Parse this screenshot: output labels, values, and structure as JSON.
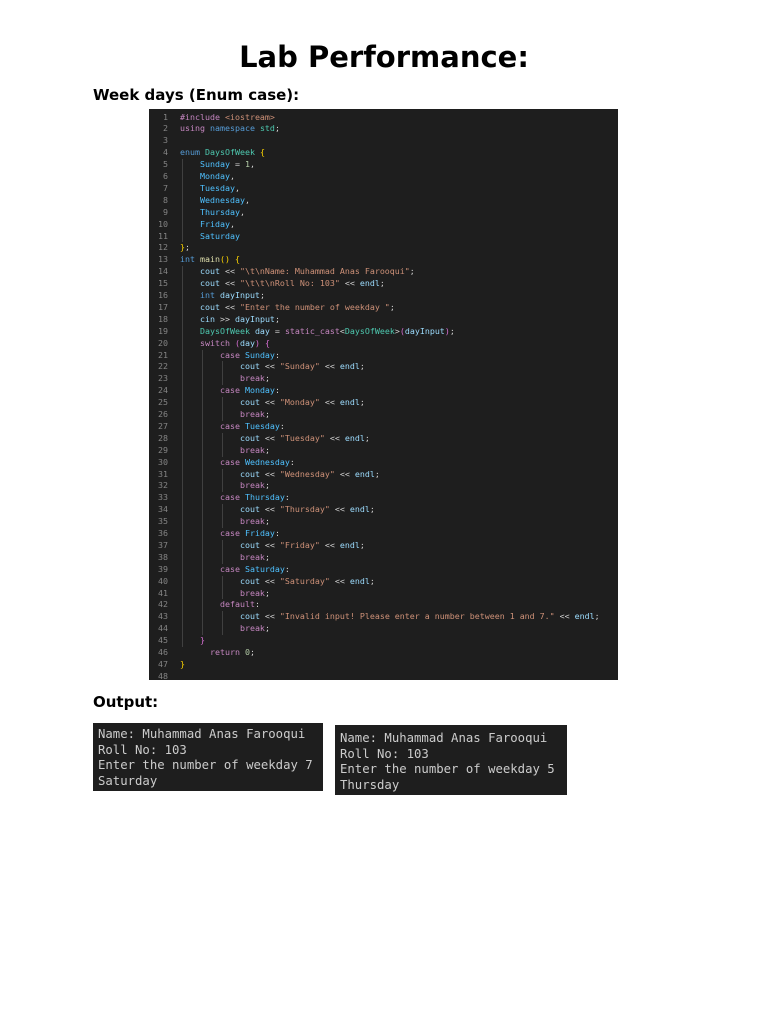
{
  "page": {
    "title": "Lab Performance:",
    "section_heading": "Week days (Enum case):",
    "output_heading": "Output:"
  },
  "code": {
    "lines": [
      {
        "n": "1",
        "tokens": [
          [
            "pre",
            "#include "
          ],
          [
            "inc",
            "<iostream>"
          ]
        ]
      },
      {
        "n": "2",
        "tokens": [
          [
            "pre",
            "using "
          ],
          [
            "kw",
            "namespace "
          ],
          [
            "ty",
            "std"
          ],
          [
            "op",
            ";"
          ]
        ]
      },
      {
        "n": "3",
        "tokens": []
      },
      {
        "n": "4",
        "tokens": [
          [
            "kw",
            "enum "
          ],
          [
            "ty",
            "DaysOfWeek "
          ],
          [
            "br1",
            "{"
          ]
        ]
      },
      {
        "n": "5",
        "tokens": [
          [
            "op",
            "    "
          ],
          [
            "enm",
            "Sunday"
          ],
          [
            "op",
            " = "
          ],
          [
            "num",
            "1"
          ],
          [
            "op",
            ","
          ]
        ]
      },
      {
        "n": "6",
        "tokens": [
          [
            "op",
            "    "
          ],
          [
            "enm",
            "Monday"
          ],
          [
            "op",
            ","
          ]
        ]
      },
      {
        "n": "7",
        "tokens": [
          [
            "op",
            "    "
          ],
          [
            "enm",
            "Tuesday"
          ],
          [
            "op",
            ","
          ]
        ]
      },
      {
        "n": "8",
        "tokens": [
          [
            "op",
            "    "
          ],
          [
            "enm",
            "Wednesday"
          ],
          [
            "op",
            ","
          ]
        ]
      },
      {
        "n": "9",
        "tokens": [
          [
            "op",
            "    "
          ],
          [
            "enm",
            "Thursday"
          ],
          [
            "op",
            ","
          ]
        ]
      },
      {
        "n": "10",
        "tokens": [
          [
            "op",
            "    "
          ],
          [
            "enm",
            "Friday"
          ],
          [
            "op",
            ","
          ]
        ]
      },
      {
        "n": "11",
        "tokens": [
          [
            "op",
            "    "
          ],
          [
            "enm",
            "Saturday"
          ]
        ]
      },
      {
        "n": "12",
        "tokens": [
          [
            "br1",
            "}"
          ],
          [
            "op",
            ";"
          ]
        ]
      },
      {
        "n": "13",
        "tokens": [
          [
            "kw",
            "int "
          ],
          [
            "fn",
            "main"
          ],
          [
            "br1",
            "()"
          ],
          [
            "op",
            " "
          ],
          [
            "br1",
            "{"
          ]
        ]
      },
      {
        "n": "14",
        "tokens": [
          [
            "op",
            "    "
          ],
          [
            "var",
            "cout"
          ],
          [
            "op",
            " << "
          ],
          [
            "str",
            "\"\\t\\nName: Muhammad Anas Farooqui\""
          ],
          [
            "op",
            ";"
          ]
        ]
      },
      {
        "n": "15",
        "tokens": [
          [
            "op",
            "    "
          ],
          [
            "var",
            "cout"
          ],
          [
            "op",
            " << "
          ],
          [
            "str",
            "\"\\t\\t\\nRoll No: 103\""
          ],
          [
            "op",
            " << "
          ],
          [
            "var",
            "endl"
          ],
          [
            "op",
            ";"
          ]
        ]
      },
      {
        "n": "16",
        "tokens": [
          [
            "op",
            "    "
          ],
          [
            "kw",
            "int "
          ],
          [
            "var",
            "dayInput"
          ],
          [
            "op",
            ";"
          ]
        ]
      },
      {
        "n": "17",
        "tokens": [
          [
            "op",
            "    "
          ],
          [
            "var",
            "cout"
          ],
          [
            "op",
            " << "
          ],
          [
            "str",
            "\"Enter the number of weekday \""
          ],
          [
            "op",
            ";"
          ]
        ]
      },
      {
        "n": "18",
        "tokens": [
          [
            "op",
            "    "
          ],
          [
            "var",
            "cin"
          ],
          [
            "op",
            " >> "
          ],
          [
            "var",
            "dayInput"
          ],
          [
            "op",
            ";"
          ]
        ]
      },
      {
        "n": "19",
        "tokens": [
          [
            "op",
            "    "
          ],
          [
            "ty",
            "DaysOfWeek "
          ],
          [
            "var",
            "day"
          ],
          [
            "op",
            " = "
          ],
          [
            "ctl",
            "static_cast"
          ],
          [
            "op",
            "<"
          ],
          [
            "ty",
            "DaysOfWeek"
          ],
          [
            "op",
            ">"
          ],
          [
            "br2",
            "("
          ],
          [
            "var",
            "dayInput"
          ],
          [
            "br2",
            ")"
          ],
          [
            "op",
            ";"
          ]
        ]
      },
      {
        "n": "20",
        "tokens": [
          [
            "op",
            "    "
          ],
          [
            "ctl",
            "switch "
          ],
          [
            "br2",
            "("
          ],
          [
            "var",
            "day"
          ],
          [
            "br2",
            ")"
          ],
          [
            "op",
            " "
          ],
          [
            "br2",
            "{"
          ]
        ]
      },
      {
        "n": "21",
        "tokens": [
          [
            "op",
            "        "
          ],
          [
            "ctl",
            "case "
          ],
          [
            "enm",
            "Sunday"
          ],
          [
            "op",
            ":"
          ]
        ]
      },
      {
        "n": "22",
        "tokens": [
          [
            "op",
            "            "
          ],
          [
            "var",
            "cout"
          ],
          [
            "op",
            " << "
          ],
          [
            "str",
            "\"Sunday\""
          ],
          [
            "op",
            " << "
          ],
          [
            "var",
            "endl"
          ],
          [
            "op",
            ";"
          ]
        ]
      },
      {
        "n": "23",
        "tokens": [
          [
            "op",
            "            "
          ],
          [
            "ctl",
            "break"
          ],
          [
            "op",
            ";"
          ]
        ]
      },
      {
        "n": "24",
        "tokens": [
          [
            "op",
            "        "
          ],
          [
            "ctl",
            "case "
          ],
          [
            "enm",
            "Monday"
          ],
          [
            "op",
            ":"
          ]
        ]
      },
      {
        "n": "25",
        "tokens": [
          [
            "op",
            "            "
          ],
          [
            "var",
            "cout"
          ],
          [
            "op",
            " << "
          ],
          [
            "str",
            "\"Monday\""
          ],
          [
            "op",
            " << "
          ],
          [
            "var",
            "endl"
          ],
          [
            "op",
            ";"
          ]
        ]
      },
      {
        "n": "26",
        "tokens": [
          [
            "op",
            "            "
          ],
          [
            "ctl",
            "break"
          ],
          [
            "op",
            ";"
          ]
        ]
      },
      {
        "n": "27",
        "tokens": [
          [
            "op",
            "        "
          ],
          [
            "ctl",
            "case "
          ],
          [
            "enm",
            "Tuesday"
          ],
          [
            "op",
            ":"
          ]
        ]
      },
      {
        "n": "28",
        "tokens": [
          [
            "op",
            "            "
          ],
          [
            "var",
            "cout"
          ],
          [
            "op",
            " << "
          ],
          [
            "str",
            "\"Tuesday\""
          ],
          [
            "op",
            " << "
          ],
          [
            "var",
            "endl"
          ],
          [
            "op",
            ";"
          ]
        ]
      },
      {
        "n": "29",
        "tokens": [
          [
            "op",
            "            "
          ],
          [
            "ctl",
            "break"
          ],
          [
            "op",
            ";"
          ]
        ]
      },
      {
        "n": "30",
        "tokens": [
          [
            "op",
            "        "
          ],
          [
            "ctl",
            "case "
          ],
          [
            "enm",
            "Wednesday"
          ],
          [
            "op",
            ":"
          ]
        ]
      },
      {
        "n": "31",
        "tokens": [
          [
            "op",
            "            "
          ],
          [
            "var",
            "cout"
          ],
          [
            "op",
            " << "
          ],
          [
            "str",
            "\"Wednesday\""
          ],
          [
            "op",
            " << "
          ],
          [
            "var",
            "endl"
          ],
          [
            "op",
            ";"
          ]
        ]
      },
      {
        "n": "32",
        "tokens": [
          [
            "op",
            "            "
          ],
          [
            "ctl",
            "break"
          ],
          [
            "op",
            ";"
          ]
        ]
      },
      {
        "n": "33",
        "tokens": [
          [
            "op",
            "        "
          ],
          [
            "ctl",
            "case "
          ],
          [
            "enm",
            "Thursday"
          ],
          [
            "op",
            ":"
          ]
        ]
      },
      {
        "n": "34",
        "tokens": [
          [
            "op",
            "            "
          ],
          [
            "var",
            "cout"
          ],
          [
            "op",
            " << "
          ],
          [
            "str",
            "\"Thursday\""
          ],
          [
            "op",
            " << "
          ],
          [
            "var",
            "endl"
          ],
          [
            "op",
            ";"
          ]
        ]
      },
      {
        "n": "35",
        "tokens": [
          [
            "op",
            "            "
          ],
          [
            "ctl",
            "break"
          ],
          [
            "op",
            ";"
          ]
        ]
      },
      {
        "n": "36",
        "tokens": [
          [
            "op",
            "        "
          ],
          [
            "ctl",
            "case "
          ],
          [
            "enm",
            "Friday"
          ],
          [
            "op",
            ":"
          ]
        ]
      },
      {
        "n": "37",
        "tokens": [
          [
            "op",
            "            "
          ],
          [
            "var",
            "cout"
          ],
          [
            "op",
            " << "
          ],
          [
            "str",
            "\"Friday\""
          ],
          [
            "op",
            " << "
          ],
          [
            "var",
            "endl"
          ],
          [
            "op",
            ";"
          ]
        ]
      },
      {
        "n": "38",
        "tokens": [
          [
            "op",
            "            "
          ],
          [
            "ctl",
            "break"
          ],
          [
            "op",
            ";"
          ]
        ]
      },
      {
        "n": "39",
        "tokens": [
          [
            "op",
            "        "
          ],
          [
            "ctl",
            "case "
          ],
          [
            "enm",
            "Saturday"
          ],
          [
            "op",
            ":"
          ]
        ]
      },
      {
        "n": "40",
        "tokens": [
          [
            "op",
            "            "
          ],
          [
            "var",
            "cout"
          ],
          [
            "op",
            " << "
          ],
          [
            "str",
            "\"Saturday\""
          ],
          [
            "op",
            " << "
          ],
          [
            "var",
            "endl"
          ],
          [
            "op",
            ";"
          ]
        ]
      },
      {
        "n": "41",
        "tokens": [
          [
            "op",
            "            "
          ],
          [
            "ctl",
            "break"
          ],
          [
            "op",
            ";"
          ]
        ]
      },
      {
        "n": "42",
        "tokens": [
          [
            "op",
            "        "
          ],
          [
            "ctl",
            "default"
          ],
          [
            "op",
            ":"
          ]
        ]
      },
      {
        "n": "43",
        "tokens": [
          [
            "op",
            "            "
          ],
          [
            "var",
            "cout"
          ],
          [
            "op",
            " << "
          ],
          [
            "str",
            "\"Invalid input! Please enter a number between 1 and 7.\""
          ],
          [
            "op",
            " << "
          ],
          [
            "var",
            "endl"
          ],
          [
            "op",
            ";"
          ]
        ]
      },
      {
        "n": "44",
        "tokens": [
          [
            "op",
            "            "
          ],
          [
            "ctl",
            "break"
          ],
          [
            "op",
            ";"
          ]
        ]
      },
      {
        "n": "45",
        "tokens": [
          [
            "op",
            "    "
          ],
          [
            "br2",
            "}"
          ]
        ]
      },
      {
        "n": "46",
        "tokens": [
          [
            "op",
            "      "
          ],
          [
            "ctl",
            "return "
          ],
          [
            "num",
            "0"
          ],
          [
            "op",
            ";"
          ]
        ]
      },
      {
        "n": "47",
        "tokens": [
          [
            "br1",
            "}"
          ]
        ]
      },
      {
        "n": "48",
        "tokens": []
      }
    ]
  },
  "outputs": [
    {
      "lines": [
        "Name: Muhammad Anas Farooqui",
        "Roll No: 103",
        "Enter the number of weekday 7",
        "Saturday"
      ]
    },
    {
      "lines": [
        "Name: Muhammad Anas Farooqui",
        "Roll No: 103",
        "Enter the number of weekday 5",
        "Thursday"
      ]
    }
  ]
}
